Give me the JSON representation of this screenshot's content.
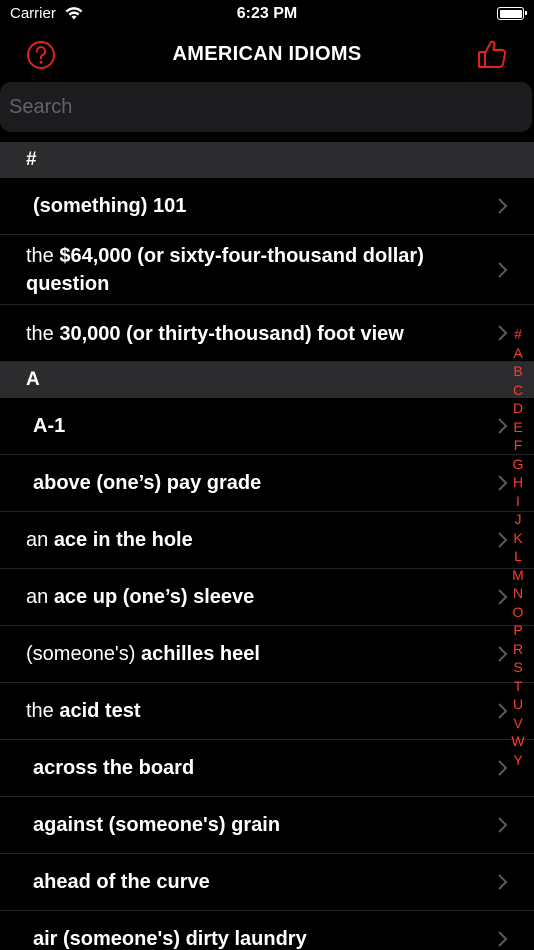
{
  "status": {
    "carrier": "Carrier",
    "time": "6:23 PM"
  },
  "nav": {
    "title": "AMERICAN IDIOMS",
    "help_icon": "question-circle-icon",
    "like_icon": "thumbs-up-icon",
    "accent": "#e0231e"
  },
  "search": {
    "placeholder": "Search",
    "value": ""
  },
  "sections": [
    {
      "header": "#",
      "rows": [
        {
          "pre": "",
          "main": "(something) 101"
        },
        {
          "pre": "the ",
          "main": "$64,000 (or sixty-four-thousand dollar) question"
        },
        {
          "pre": "the ",
          "main": "30,000 (or thirty-thousand) foot view"
        }
      ]
    },
    {
      "header": "A",
      "rows": [
        {
          "pre": "",
          "main": "A-1"
        },
        {
          "pre": "",
          "main": "above (one’s) pay grade"
        },
        {
          "pre": "an ",
          "main": "ace in the hole"
        },
        {
          "pre": "an ",
          "main": "ace up (one’s) sleeve"
        },
        {
          "pre": "(someone's) ",
          "main": "achilles heel"
        },
        {
          "pre": "the ",
          "main": "acid test"
        },
        {
          "pre": "",
          "main": "across the board"
        },
        {
          "pre": "",
          "main": "against (someone's) grain"
        },
        {
          "pre": "",
          "main": "ahead of the curve"
        },
        {
          "pre": "",
          "main": "air (someone's) dirty laundry"
        }
      ]
    }
  ],
  "index": [
    "#",
    "A",
    "B",
    "C",
    "D",
    "E",
    "F",
    "G",
    "H",
    "I",
    "J",
    "K",
    "L",
    "M",
    "N",
    "O",
    "P",
    "R",
    "S",
    "T",
    "U",
    "V",
    "W",
    "Y"
  ],
  "colors": {
    "index": "#ff3b30",
    "section_bg": "#2c2c2e",
    "search_bg": "#1c1c1e"
  }
}
